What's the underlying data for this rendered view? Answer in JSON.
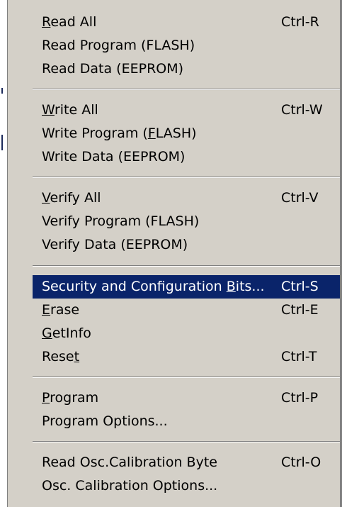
{
  "menu": {
    "groups": [
      {
        "items": [
          {
            "label": "Read All",
            "shortcut": "Ctrl-R",
            "accel": "R"
          },
          {
            "label": "Read Program (FLASH)",
            "shortcut": ""
          },
          {
            "label": "Read Data (EEPROM)",
            "shortcut": ""
          }
        ]
      },
      {
        "items": [
          {
            "label": "Write All",
            "shortcut": "Ctrl-W",
            "accel": "W"
          },
          {
            "label": "Write Program (FLASH)",
            "shortcut": "",
            "accel": "F"
          },
          {
            "label": "Write Data (EEPROM)",
            "shortcut": ""
          }
        ]
      },
      {
        "items": [
          {
            "label": "Verify All",
            "shortcut": "Ctrl-V",
            "accel": "V"
          },
          {
            "label": "Verify Program (FLASH)",
            "shortcut": ""
          },
          {
            "label": "Verify Data (EEPROM)",
            "shortcut": ""
          }
        ]
      },
      {
        "items": [
          {
            "label": "Security and Configuration Bits...",
            "shortcut": "Ctrl-S",
            "accel": "B",
            "highlighted": true
          },
          {
            "label": "Erase",
            "shortcut": "Ctrl-E",
            "accel": "E"
          },
          {
            "label": "GetInfo",
            "shortcut": "",
            "accel": "G"
          },
          {
            "label": "Reset",
            "shortcut": "Ctrl-T",
            "accel": "t"
          }
        ]
      },
      {
        "items": [
          {
            "label": "Program",
            "shortcut": "Ctrl-P",
            "accel": "P"
          },
          {
            "label": "Program Options...",
            "shortcut": ""
          }
        ]
      },
      {
        "items": [
          {
            "label": "Read Osc.Calibration Byte",
            "shortcut": "Ctrl-O"
          },
          {
            "label": "Osc. Calibration Options...",
            "shortcut": ""
          }
        ]
      }
    ]
  },
  "colors": {
    "menu_bg": "#d4d0c8",
    "highlight_bg": "#0a246a",
    "highlight_fg": "#ffffff",
    "separator_dark": "#808080",
    "separator_light": "#ffffff"
  }
}
